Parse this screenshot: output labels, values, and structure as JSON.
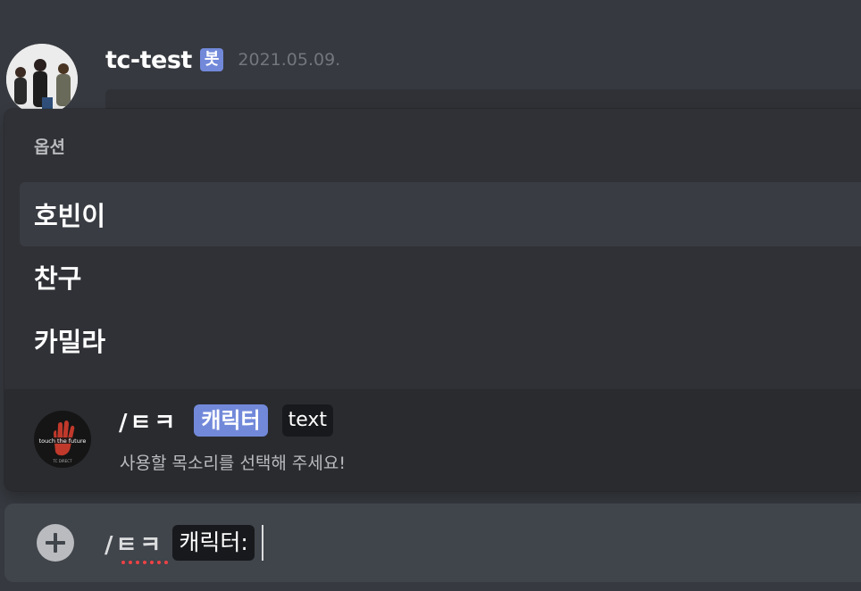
{
  "message": {
    "username": "tc-test",
    "bot_badge": "봇",
    "timestamp": "2021.05.09."
  },
  "popup": {
    "title": "옵션",
    "options": [
      {
        "label": "호빈이",
        "selected": true
      },
      {
        "label": "찬구",
        "selected": false
      },
      {
        "label": "카밀라",
        "selected": false
      }
    ],
    "command": {
      "name": "/ㅌㅋ",
      "active_param": "캐릭터",
      "param": "text",
      "description": "사용할 목소리를 선택해 주세요!"
    }
  },
  "input": {
    "command": "/ㅌㅋ",
    "param": "캐릭터:"
  },
  "colors": {
    "background": "#36393f",
    "popup": "#2f3136",
    "accent": "#7289da",
    "input": "#40444b"
  }
}
